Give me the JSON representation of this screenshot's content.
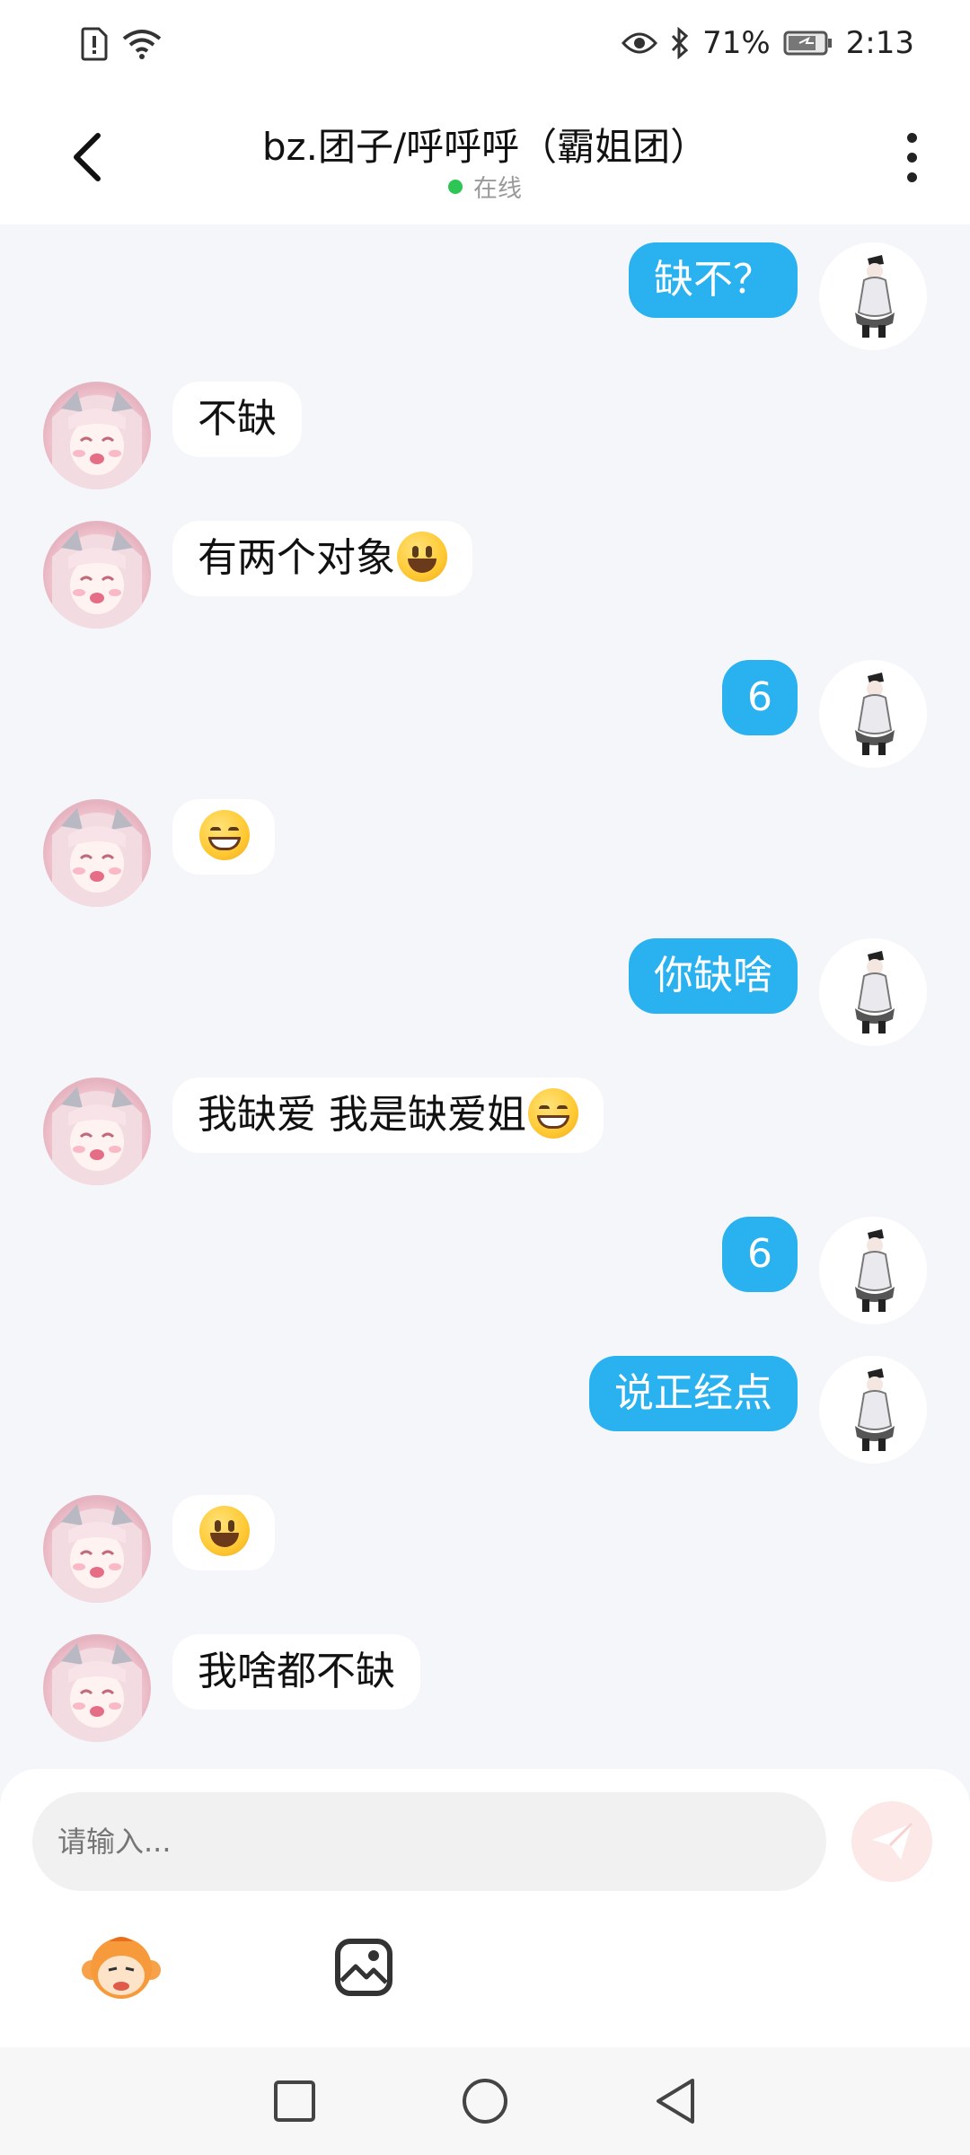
{
  "status_bar": {
    "battery_percent": "71%",
    "time": "2:13",
    "icons": [
      "sim-alert-icon",
      "wifi-icon",
      "eye-icon",
      "bluetooth-icon",
      "battery-icon"
    ]
  },
  "header": {
    "title": "bz.团子/呼呼呼（霸姐团）",
    "status": "在线",
    "online_color": "#2dc655"
  },
  "messages": [
    {
      "side": "right",
      "text": "缺不？"
    },
    {
      "side": "left",
      "text": "不缺"
    },
    {
      "side": "left",
      "text": "有两个对象",
      "emoji": "smile"
    },
    {
      "side": "right",
      "text": "6"
    },
    {
      "side": "left",
      "text": "",
      "emoji": "grin"
    },
    {
      "side": "right",
      "text": "你缺啥"
    },
    {
      "side": "left",
      "text": "我缺爱 我是缺爱姐",
      "emoji": "grin"
    },
    {
      "side": "right",
      "text": "6"
    },
    {
      "side": "right",
      "text": "说正经点"
    },
    {
      "side": "left",
      "text": "",
      "emoji": "smile"
    },
    {
      "side": "left",
      "text": "我啥都不缺"
    }
  ],
  "colors": {
    "outgoing_bubble": "#2ab1ef",
    "incoming_bubble": "#ffffff",
    "background": "#f4f6f9"
  },
  "input": {
    "placeholder": "请输入..."
  }
}
